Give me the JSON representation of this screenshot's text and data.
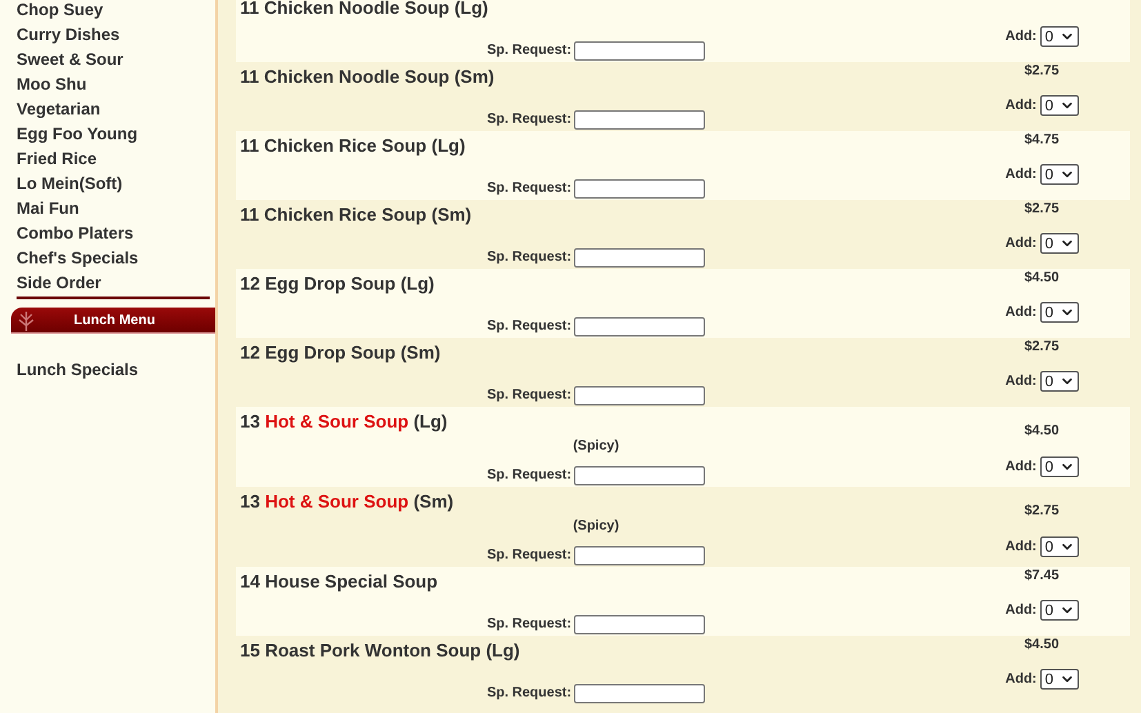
{
  "sidebar": {
    "items": [
      "Chop Suey",
      "Curry Dishes",
      "Sweet & Sour",
      "Moo Shu",
      "Vegetarian",
      "Egg Foo Young",
      "Fried Rice",
      "Lo Mein(Soft)",
      "Mai Fun",
      "Combo Platers",
      "Chef's Specials",
      "Side Order"
    ],
    "section_header": "Lunch Menu",
    "section_items": [
      "Lunch Specials"
    ]
  },
  "menu_items": [
    {
      "number": "11",
      "name": "Chicken Noodle Soup",
      "size": "(Lg)",
      "highlighted": false,
      "request_label": "Sp. Request:",
      "add_label": "Add:",
      "quantity": "0"
    },
    {
      "number": "11",
      "name": "Chicken Noodle Soup",
      "size": "(Sm)",
      "highlighted": false,
      "price": "$2.75",
      "request_label": "Sp. Request:",
      "add_label": "Add:",
      "quantity": "0"
    },
    {
      "number": "11",
      "name": "Chicken Rice Soup",
      "size": "(Lg)",
      "highlighted": false,
      "price": "$4.75",
      "request_label": "Sp. Request:",
      "add_label": "Add:",
      "quantity": "0"
    },
    {
      "number": "11",
      "name": "Chicken Rice Soup",
      "size": "(Sm)",
      "highlighted": false,
      "price": "$2.75",
      "request_label": "Sp. Request:",
      "add_label": "Add:",
      "quantity": "0"
    },
    {
      "number": "12",
      "name": "Egg Drop Soup",
      "size": "(Lg)",
      "highlighted": false,
      "price": "$4.50",
      "request_label": "Sp. Request:",
      "add_label": "Add:",
      "quantity": "0"
    },
    {
      "number": "12",
      "name": "Egg Drop Soup",
      "size": "(Sm)",
      "highlighted": false,
      "price": "$2.75",
      "request_label": "Sp. Request:",
      "add_label": "Add:",
      "quantity": "0"
    },
    {
      "number": "13",
      "name": "Hot & Sour Soup",
      "size": "(Lg)",
      "highlighted": true,
      "note": "(Spicy)",
      "price": "$4.50",
      "request_label": "Sp. Request:",
      "add_label": "Add:",
      "quantity": "0"
    },
    {
      "number": "13",
      "name": "Hot & Sour Soup",
      "size": "(Sm)",
      "highlighted": true,
      "note": "(Spicy)",
      "price": "$2.75",
      "request_label": "Sp. Request:",
      "add_label": "Add:",
      "quantity": "0"
    },
    {
      "number": "14",
      "name": "House Special Soup",
      "highlighted": false,
      "price": "$7.45",
      "request_label": "Sp. Request:",
      "add_label": "Add:",
      "quantity": "0"
    },
    {
      "number": "15",
      "name": "Roast Pork Wonton Soup",
      "size": "(Lg)",
      "highlighted": false,
      "price": "$4.50",
      "request_label": "Sp. Request:",
      "add_label": "Add:",
      "quantity": "0"
    }
  ]
}
